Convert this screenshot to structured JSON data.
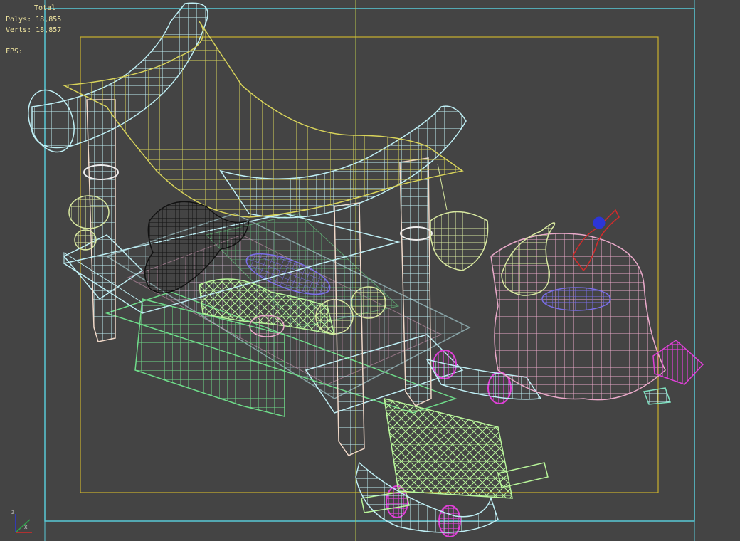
{
  "viewport": {
    "stats": {
      "header": "Total",
      "polys": "Polys: 18,855",
      "verts": "Verts: 18,857",
      "fps": "FPS:"
    },
    "axis_labels": {
      "x": "x",
      "z": "z"
    },
    "colors": {
      "background": "#444444",
      "safe_frame_outer": "#58c9d6",
      "safe_frame_inner": "#c9b12e",
      "guide_line": "#b9c64a",
      "stats_text": "#f2e7a0",
      "wire_cyan": "#bfeff5",
      "wire_yellow": "#d8d35a",
      "wire_pink": "#e9a9c9",
      "wire_green": "#8fe08f",
      "wire_lightgreen": "#b8f59a",
      "wire_purple": "#7a6ee6",
      "wire_magenta": "#e040d8",
      "wire_black": "#111111",
      "wire_red": "#d42b2b",
      "wire_blue": "#2d36d6",
      "wire_mint": "#7fe0c0",
      "wire_white": "#eeeeee"
    }
  }
}
